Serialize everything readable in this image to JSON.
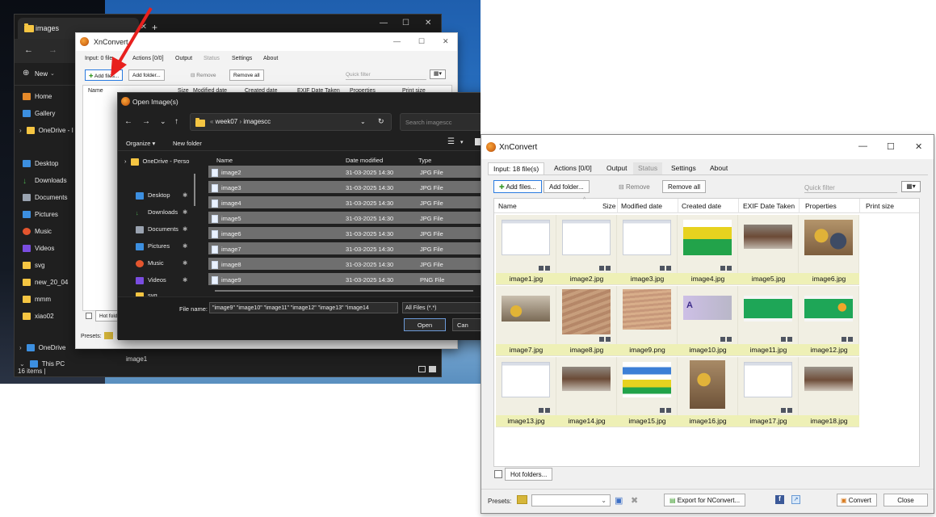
{
  "left_shot": {
    "explorer": {
      "tab_title": "images",
      "new_label": "New",
      "sidebar": [
        "Home",
        "Gallery",
        "OneDrive - I",
        "Desktop",
        "Downloads",
        "Documents",
        "Pictures",
        "Music",
        "Videos",
        "svg",
        "new_20_04",
        "mmm",
        "xiao02",
        "OneDrive",
        "This PC"
      ],
      "status": "16 items  |",
      "bottom_file": "image1"
    },
    "xnconvert_small": {
      "title": "XnConvert",
      "tabs": [
        "Input: 0 file",
        "Actions [0/0]",
        "Output",
        "Status",
        "Settings",
        "About"
      ],
      "add_files": "Add files...",
      "add_folder": "Add folder...",
      "remove": "Remove",
      "remove_all": "Remove all",
      "quick_filter": "Quick filter",
      "columns": [
        "Name",
        "Size",
        "Modified date",
        "Created date",
        "EXIF Date Taken",
        "Properties",
        "Print size"
      ],
      "hot_folders": "Hot folde",
      "presets": "Presets:"
    },
    "open_dialog": {
      "title": "Open Image(s)",
      "path": [
        "week07",
        "imagescc"
      ],
      "search_placeholder": "Search imagescc",
      "organize": "Organize",
      "new_folder": "New folder",
      "side": [
        "OneDrive - Perso",
        "Desktop",
        "Downloads",
        "Documents",
        "Pictures",
        "Music",
        "Videos",
        "svg"
      ],
      "columns": [
        "Name",
        "Date modified",
        "Type"
      ],
      "files": [
        {
          "name": "image2",
          "date": "31-03-2025 14:30",
          "type": "JPG File"
        },
        {
          "name": "image3",
          "date": "31-03-2025 14:30",
          "type": "JPG File"
        },
        {
          "name": "image4",
          "date": "31-03-2025 14:30",
          "type": "JPG File"
        },
        {
          "name": "image5",
          "date": "31-03-2025 14:30",
          "type": "JPG File"
        },
        {
          "name": "image6",
          "date": "31-03-2025 14:30",
          "type": "JPG File"
        },
        {
          "name": "image7",
          "date": "31-03-2025 14:30",
          "type": "JPG File"
        },
        {
          "name": "image8",
          "date": "31-03-2025 14:30",
          "type": "JPG File"
        },
        {
          "name": "image9",
          "date": "31-03-2025 14:30",
          "type": "PNG File"
        }
      ],
      "file_name_label": "File name:",
      "file_name_value": "\"image9\" \"image10\" \"image11\" \"image12\" \"image13\" \"image14",
      "filter": "All Files (*.*)",
      "open": "Open",
      "cancel": "Can"
    }
  },
  "xnconvert": {
    "title": "XnConvert",
    "tabs": [
      "Input: 18 file(s)",
      "Actions [0/0]",
      "Output",
      "Status",
      "Settings",
      "About"
    ],
    "toolbar": {
      "add_files": "Add files...",
      "add_folder": "Add folder...",
      "remove": "Remove",
      "remove_all": "Remove all",
      "quick_filter_placeholder": "Quick filter"
    },
    "columns": [
      "Name",
      "Size",
      "Modified date",
      "Created date",
      "EXIF Date Taken",
      "Properties",
      "Print size"
    ],
    "thumbnails": [
      "image1.jpg",
      "image2.jpg",
      "image3.jpg",
      "image4.jpg",
      "image5.jpg",
      "image6.jpg",
      "image7.jpg",
      "image8.jpg",
      "image9.png",
      "image10.jpg",
      "image11.jpg",
      "image12.jpg",
      "image13.jpg",
      "image14.jpg",
      "image15.jpg",
      "image16.jpg",
      "image17.jpg",
      "image18.jpg"
    ],
    "hot_folders": "Hot folders...",
    "presets_label": "Presets:",
    "export_label": "Export for NConvert...",
    "convert_label": "Convert",
    "close_label": "Close"
  },
  "colors": {
    "accent": "#2a7be0",
    "thumb_label_bg": "#eef0b6",
    "arrow": "#e8201e"
  }
}
